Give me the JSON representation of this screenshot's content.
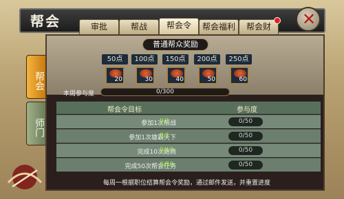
{
  "window": {
    "title": "帮会"
  },
  "tabs": [
    {
      "label": "审批"
    },
    {
      "label": "帮战"
    },
    {
      "label": "帮会令",
      "active": true
    },
    {
      "label": "帮会福利"
    },
    {
      "label": "帮会财"
    }
  ],
  "side_tabs": [
    {
      "label": "帮会",
      "active": true
    },
    {
      "label": "师门"
    }
  ],
  "reward": {
    "title": "普通帮众奖励",
    "tiers": [
      {
        "label": "50点",
        "count": "20"
      },
      {
        "label": "100点",
        "count": "30"
      },
      {
        "label": "150点",
        "count": "40"
      },
      {
        "label": "200点",
        "count": "50"
      },
      {
        "label": "250点",
        "count": "60"
      }
    ],
    "weekly_label": "本周参与度",
    "weekly_value": "0/300",
    "weekly_fraction": 0
  },
  "table": {
    "col_goal": "帮会令目标",
    "col_progress": "参与度",
    "rows": [
      {
        "goal": "参加1次帮战",
        "count": "0/1",
        "progress": "0/50"
      },
      {
        "goal": "参加1次雄霸天下",
        "count": "0/1",
        "progress": "0/50"
      },
      {
        "goal": "完成10次跑商",
        "count": "0/10",
        "progress": "0/50"
      },
      {
        "goal": "完成50次帮会任务",
        "count": "0/50",
        "progress": "0/50"
      }
    ]
  },
  "notice": "每周一根据职位结算帮会令奖励，通过邮件发送，并重置进度",
  "colors": {
    "accent": "#d9a73b",
    "count_green": "#a4f13a"
  }
}
